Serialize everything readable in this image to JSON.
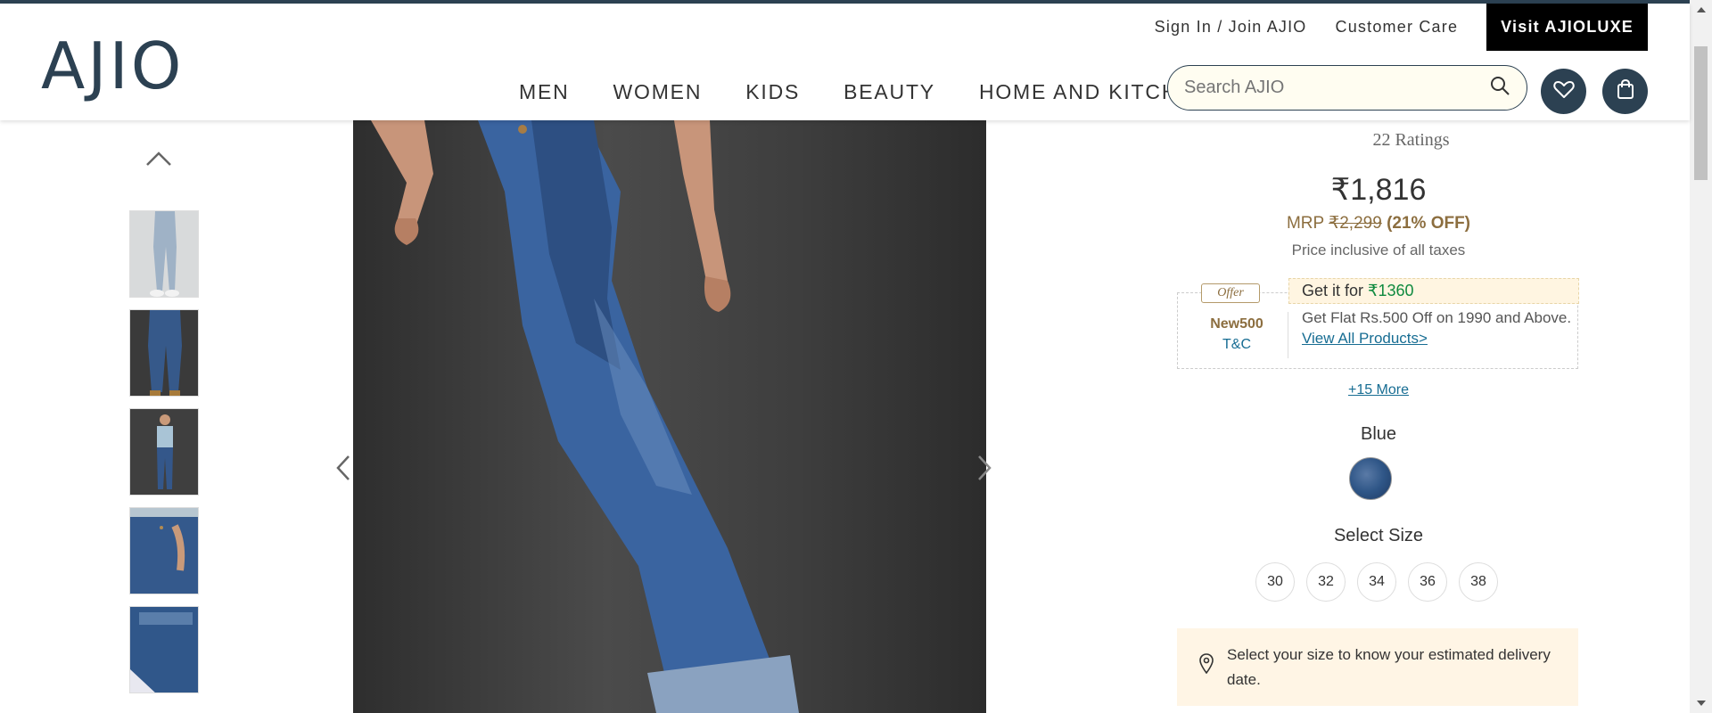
{
  "header": {
    "logo": "AJIO",
    "top_links": [
      "Sign In / Join AJIO",
      "Customer Care"
    ],
    "luxe_button": "Visit AJIOLUXE",
    "nav": [
      "MEN",
      "WOMEN",
      "KIDS",
      "BEAUTY",
      "HOME AND KITCHEN"
    ],
    "search_placeholder": "Search AJIO",
    "icons": [
      "search-icon",
      "heart-icon",
      "bag-icon"
    ]
  },
  "gallery": {
    "thumbnail_count": 5
  },
  "product": {
    "ratings": "22 Ratings",
    "price": "₹1,816",
    "mrp_label": "MRP",
    "mrp_value": "₹2,299",
    "discount": "(21% OFF)",
    "tax_note": "Price inclusive of all taxes",
    "offer": {
      "tag": "Offer",
      "get_it_label": "Get it for",
      "get_it_price": "₹1360",
      "code": "New500",
      "tc": "T&C",
      "description": "Get Flat Rs.500 Off on 1990 and Above.",
      "view_all": "View All Products>"
    },
    "more_offers": "+15 More",
    "color": "Blue",
    "size_title": "Select Size",
    "sizes": [
      "30",
      "32",
      "34",
      "36",
      "38"
    ],
    "delivery_text": "Select your size to know your estimated delivery date."
  },
  "colors": {
    "brand": "#2c4152",
    "gold": "#8c6e3f",
    "link": "#176d93",
    "green": "#0f8a3f"
  }
}
